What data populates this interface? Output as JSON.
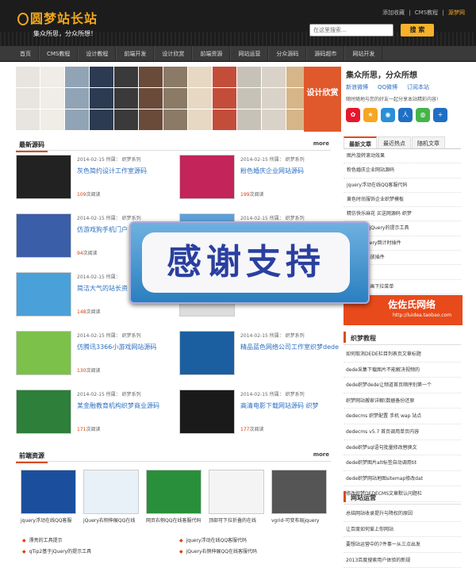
{
  "header": {
    "logo": "圆梦站长站",
    "slogan": "集众所思，分众所想！",
    "links": [
      "添加收藏",
      "|",
      "CMS教程",
      "|"
    ],
    "links_highlight": "源梦网",
    "search_placeholder": "在这里搜索...",
    "search_button": "搜 索"
  },
  "nav": [
    "首页",
    "CMS教程",
    "设计教程",
    "前端开发",
    "设计欣赏",
    "前端资源",
    "网站运营",
    "分众源码",
    "源码超市",
    "网站开发"
  ],
  "banner": {
    "label": "设计欣赏"
  },
  "share": {
    "title": "集众所思，分众所想",
    "links": [
      "新浪微博",
      "QQ微博",
      "订阅本站"
    ],
    "tip": "随时随地与您的好友一起分享本站精彩内容!",
    "icons": [
      {
        "name": "sina-icon",
        "glyph": "✿",
        "color": "#e6162d"
      },
      {
        "name": "qzone-icon",
        "glyph": "★",
        "color": "#f5a623"
      },
      {
        "name": "tencent-weibo-icon",
        "glyph": "◉",
        "color": "#2a8fd8"
      },
      {
        "name": "renren-icon",
        "glyph": "人",
        "color": "#1e6fc5"
      },
      {
        "name": "wechat-icon",
        "glyph": "◍",
        "color": "#44b549"
      },
      {
        "name": "more-share-icon",
        "glyph": "+",
        "color": "#1e6fc5"
      }
    ]
  },
  "latest": {
    "title": "最新源码",
    "more": "more"
  },
  "items": [
    {
      "meta": "2014-02-15 所属： 织梦系列",
      "title": "灰色简约设计工作室源码",
      "reads": "109",
      "read_suffix": "次阅读"
    },
    {
      "meta": "2014-02-15 所属： 织梦系列",
      "title": "粉色婚庆企业网站源码",
      "reads": "199",
      "read_suffix": "次阅读"
    },
    {
      "meta": "2014-02-15 所属： 织梦系列",
      "title": "仿游戏狗手机门户",
      "reads": "94",
      "read_suffix": "次阅读"
    },
    {
      "meta": "2014-02-15 所属： 织梦系列",
      "title": "",
      "reads": "",
      "read_suffix": ""
    },
    {
      "meta": "2014-02-15 所属：",
      "title": "简洁大气的站长资",
      "reads": "148",
      "read_suffix": "次阅读"
    },
    {
      "meta": "",
      "title": "",
      "reads": "",
      "read_suffix": ""
    },
    {
      "meta": "2014-02-15 所属： 织梦系列",
      "title": "仿腾讯3366小游戏网站源码",
      "reads": "130",
      "read_suffix": "次阅读"
    },
    {
      "meta": "2014-02-15 所属： 织梦系列",
      "title": "精品蓝色网络公司工作室织梦dedecms模板",
      "reads": "",
      "read_suffix": ""
    },
    {
      "meta": "2014-02-15 所属： 织梦系列",
      "title": "某金融教育机构织梦商业源码",
      "reads": "171",
      "read_suffix": "次阅读"
    },
    {
      "meta": "2014-02-15 所属： 织梦系列",
      "title": "高清电影下载网站源码 织梦",
      "reads": "177",
      "read_suffix": "次阅读"
    }
  ],
  "side_tabs": [
    "最新文章",
    "最近热点",
    "随机文章"
  ],
  "side_list": [
    "图片旋转滚动效果",
    "粉色婚庆企业网站源码",
    "jquery浮动在线QQ客服代码",
    "黄色时尚服饰企业织梦模板",
    "精仿快乐麻花 买送网源码 织梦",
    "qTip2基于jQuery的提示工具",
    "tab...: jquery倒计时插件",
    "...的图片播放插件",
    "...提示",
    "jq...悬停动画下拉菜单"
  ],
  "ad": {
    "title": "佐佐氏网络",
    "url": "http://luidea.taobao.com"
  },
  "side2": {
    "title": "织梦教程",
    "items": [
      "如何取消DEDE栏目列表页文章标题",
      "dede采集下载图片不能解决视频的",
      "dede织梦dede让频道首页顺序别第一个",
      "织梦网站搬家详解(数据备份还原",
      "dedecms 织梦配置 手机 wap 站点",
      "dedecms v5.7 首页调用单页内容",
      "dede织梦sql语句批量修改替换文",
      "dede织梦图片alt标签自动调用tit",
      "dede织梦网站地图sitemap修改dat",
      "修改织梦DEDECMS文章默认问题栏"
    ]
  },
  "side3": {
    "title": "网站运营",
    "items": [
      "总结网站收录提升与降权的原因",
      "让百度如何爱上你网站",
      "要想站运营中的7件事一从三点出发",
      "2013百度搜索用户体验的新规"
    ]
  },
  "front": {
    "title": "前端资源",
    "more": "more"
  },
  "front_items": [
    "jquery浮动在线QQ客服",
    "jQuery右侧伸展QQ在线",
    "网页右侧QQ在线客服代码",
    "顶部可下拉折叠的在线",
    "vgrid-可变布局jquery"
  ],
  "front_links": [
    [
      "漂亮的工具提示",
      "qTip2基于jQuery的提示工具"
    ],
    [
      "jquery浮动在线QQ客服代码",
      "jQuery右侧伸展QQ在线客服代码"
    ]
  ],
  "overlay": "感谢支持"
}
